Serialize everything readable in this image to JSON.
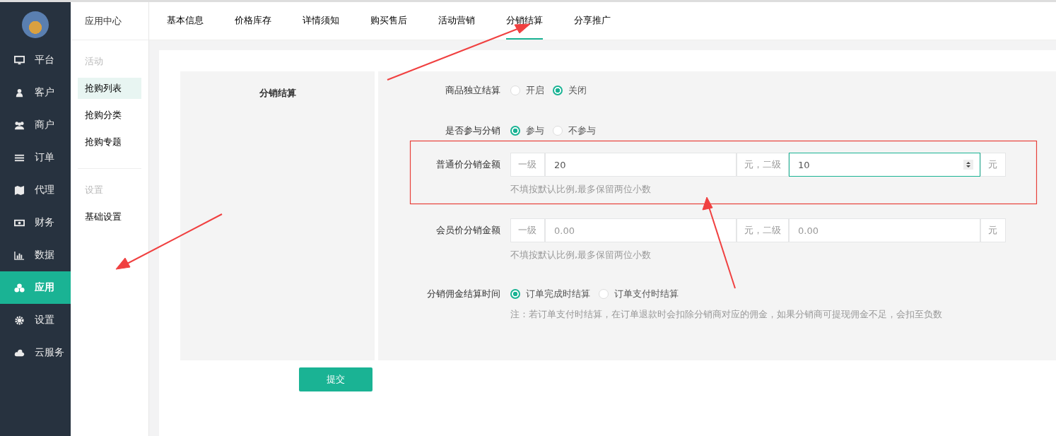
{
  "sidebar": {
    "items": [
      {
        "label": "平台",
        "selected": false
      },
      {
        "label": "客户",
        "selected": false
      },
      {
        "label": "商户",
        "selected": false
      },
      {
        "label": "订单",
        "selected": false
      },
      {
        "label": "代理",
        "selected": false
      },
      {
        "label": "财务",
        "selected": false
      },
      {
        "label": "数据",
        "selected": false
      },
      {
        "label": "应用",
        "selected": true
      },
      {
        "label": "设置",
        "selected": false
      },
      {
        "label": "云服务",
        "selected": false
      }
    ]
  },
  "subnav": {
    "title": "应用中心",
    "groups": [
      {
        "heading": "活动",
        "items": [
          {
            "label": "抢购列表",
            "selected": true
          },
          {
            "label": "抢购分类",
            "selected": false
          },
          {
            "label": "抢购专题",
            "selected": false
          }
        ]
      },
      {
        "heading": "设置",
        "items": [
          {
            "label": "基础设置",
            "selected": false
          }
        ]
      }
    ]
  },
  "tabs": [
    {
      "label": "基本信息",
      "selected": false
    },
    {
      "label": "价格库存",
      "selected": false
    },
    {
      "label": "详情须知",
      "selected": false
    },
    {
      "label": "购买售后",
      "selected": false
    },
    {
      "label": "活动营销",
      "selected": false
    },
    {
      "label": "分销结算",
      "selected": true
    },
    {
      "label": "分享推广",
      "selected": false
    }
  ],
  "form": {
    "section_title": "分销结算",
    "rows": [
      {
        "kind": "radio",
        "label": "商品独立结算",
        "options": [
          {
            "label": "开启",
            "selected": false
          },
          {
            "label": "关闭",
            "selected": true
          }
        ]
      },
      {
        "kind": "radio",
        "label": "是否参与分销",
        "options": [
          {
            "label": "参与",
            "selected": true
          },
          {
            "label": "不参与",
            "selected": false
          }
        ]
      },
      {
        "kind": "amount",
        "label": "普通价分销金额",
        "prefix": "一级",
        "middle": "元，二级",
        "suffix": "元",
        "level1": {
          "value": "20",
          "focused": false
        },
        "level2": {
          "value": "10",
          "focused": true
        },
        "hint": "不填按默认比例,最多保留两位小数"
      },
      {
        "kind": "amount",
        "label": "会员价分销金额",
        "prefix": "一级",
        "middle": "元，二级",
        "suffix": "元",
        "level1": {
          "placeholder": "0.00",
          "focused": false
        },
        "level2": {
          "placeholder": "0.00",
          "focused": false
        },
        "hint": "不填按默认比例,最多保留两位小数"
      },
      {
        "kind": "radio",
        "label": "分销佣金结算时间",
        "options": [
          {
            "label": "订单完成时结算",
            "selected": true
          },
          {
            "label": "订单支付时结算",
            "selected": false
          }
        ],
        "hint": "注：若订单支付时结算，在订单退款时会扣除分销商对应的佣金，如果分销商可提现佣金不足，会扣至负数"
      }
    ]
  },
  "submit_button": "提交"
}
